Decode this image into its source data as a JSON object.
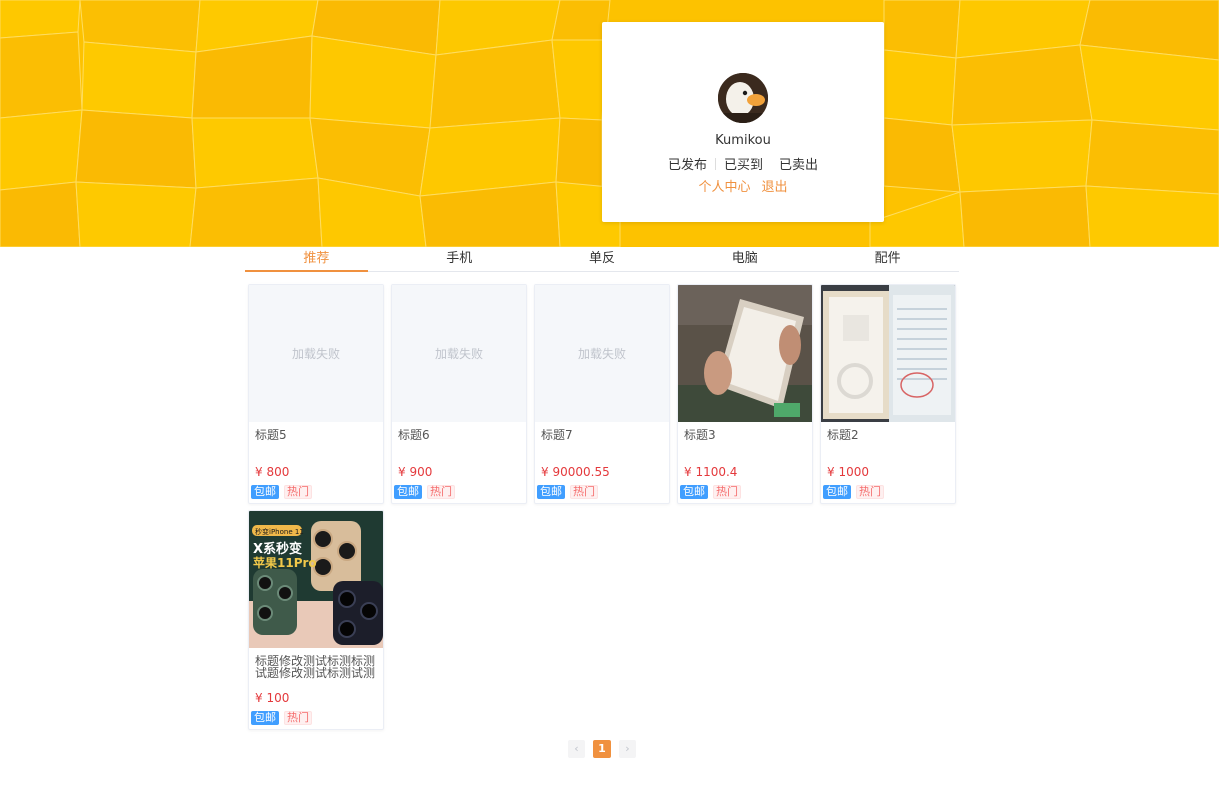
{
  "profile": {
    "username": "Kumikou",
    "stats": [
      "已发布",
      "已买到",
      "已卖出"
    ],
    "links": {
      "center": "个人中心",
      "logout": "退出"
    }
  },
  "tabs": [
    "推荐",
    "手机",
    "单反",
    "电脑",
    "配件"
  ],
  "active_tab": "推荐",
  "products": [
    {
      "title": "标题5",
      "price": "¥ 800",
      "image": "加载失败",
      "tag_ship": "包邮",
      "tag_hot": "热门"
    },
    {
      "title": "标题6",
      "price": "¥ 900",
      "image": "加载失败",
      "tag_ship": "包邮",
      "tag_hot": "热门"
    },
    {
      "title": "标题7",
      "price": "¥ 90000.55",
      "image": "加载失败",
      "tag_ship": "包邮",
      "tag_hot": "热门"
    },
    {
      "title": "标题3",
      "price": "¥ 1100.4",
      "tag_ship": "包邮",
      "tag_hot": "热门"
    },
    {
      "title": "标题2",
      "price": "¥ 1000",
      "tag_ship": "包邮",
      "tag_hot": "热门"
    },
    {
      "title": "标题修改测试标测标测试题修改测试标测试测",
      "price": "¥ 100",
      "tag_ship": "包邮",
      "tag_hot": "热门",
      "image_text": {
        "badge": "秒变iPhone 11",
        "line1": "X系秒变",
        "line2": "苹果11Pro"
      }
    }
  ],
  "pagination": {
    "current": "1",
    "prev_icon": "chevron-left-icon",
    "next_icon": "chevron-right-icon"
  },
  "colors": {
    "accent": "#f0913f",
    "price": "#e4393c",
    "banner": "#fdc200",
    "tag_ship": "#409eff",
    "tag_hot": "#f56c6c"
  }
}
